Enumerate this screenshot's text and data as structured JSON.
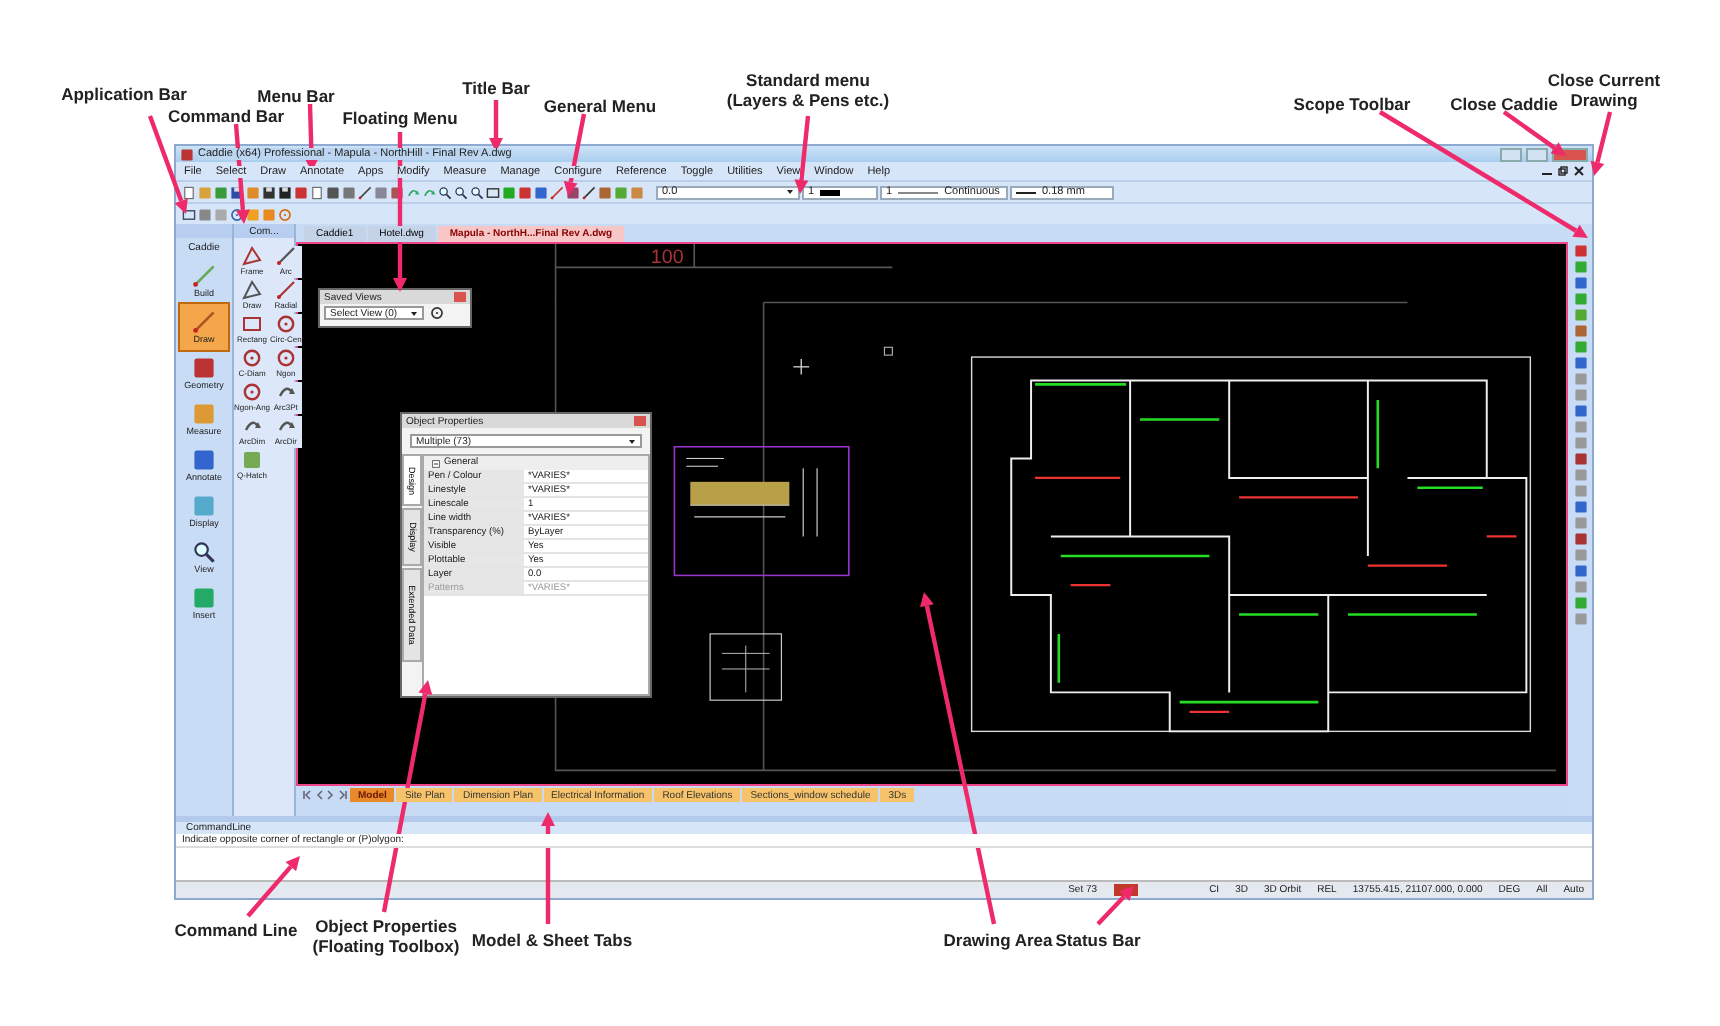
{
  "annotations": [
    {
      "lines": [
        "Application Bar"
      ]
    },
    {
      "lines": [
        "Command Bar"
      ]
    },
    {
      "lines": [
        "Menu Bar"
      ]
    },
    {
      "lines": [
        "Floating Menu"
      ]
    },
    {
      "lines": [
        "Title Bar"
      ]
    },
    {
      "lines": [
        "General Menu"
      ]
    },
    {
      "lines": [
        "Standard menu",
        "(Layers & Pens etc.)"
      ]
    },
    {
      "lines": [
        "Scope Toolbar"
      ]
    },
    {
      "lines": [
        "Close Caddie"
      ]
    },
    {
      "lines": [
        "Close Current",
        "Drawing"
      ]
    },
    {
      "lines": [
        "Command Line"
      ]
    },
    {
      "lines": [
        "Object Properties",
        "(Floating Toolbox)"
      ]
    },
    {
      "lines": [
        "Model & Sheet Tabs"
      ]
    },
    {
      "lines": [
        "Drawing Area"
      ]
    },
    {
      "lines": [
        "Status Bar"
      ]
    }
  ],
  "window": {
    "title": "Caddie (x64) Professional - Mapula - NorthHill - Final Rev A.dwg"
  },
  "menu": [
    "File",
    "Select",
    "Draw",
    "Annotate",
    "Apps",
    "Modify",
    "Measure",
    "Manage",
    "Configure",
    "Reference",
    "Toggle",
    "Utilities",
    "View",
    "Window",
    "Help"
  ],
  "standard_toolbar": {
    "layer": "0.0",
    "pen": "1",
    "linestyle_pen": "1",
    "linestyle": "Continuous",
    "line_width": "0.18 mm"
  },
  "application_bar": {
    "title": "Caddie",
    "items": [
      {
        "label": "Build",
        "selected": false
      },
      {
        "label": "Draw",
        "selected": true
      },
      {
        "label": "Geometry",
        "selected": false
      },
      {
        "label": "Measure",
        "selected": false
      },
      {
        "label": "Annotate",
        "selected": false
      },
      {
        "label": "Display",
        "selected": false
      },
      {
        "label": "View",
        "selected": false
      },
      {
        "label": "Insert",
        "selected": false
      }
    ]
  },
  "command_bar": {
    "title": "Com...",
    "tools": [
      "Frame",
      "Arc",
      "Draw",
      "Radial",
      "Rectang",
      "Circ-Cen",
      "C-Diam",
      "Ngon",
      "Ngon-Ang",
      "Arc3Pt",
      "ArcDim",
      "ArcDir",
      "Q-Hatch"
    ]
  },
  "document_tabs": [
    {
      "label": "Caddie1",
      "selected": false
    },
    {
      "label": "Hotel.dwg",
      "selected": false
    },
    {
      "label": "Mapula - NorthH...Final Rev A.dwg",
      "selected": true
    }
  ],
  "drawing": {
    "scale_label": "100"
  },
  "saved_views": {
    "title": "Saved Views",
    "select": "Select View (0)"
  },
  "object_properties": {
    "title": "Object Properties",
    "select": "Multiple (73)",
    "side_tabs": [
      {
        "label": "Design",
        "selected": true
      },
      {
        "label": "Display",
        "selected": false
      },
      {
        "label": "Extended Data",
        "selected": false
      }
    ],
    "group": "General",
    "rows": [
      {
        "name": "Pen / Colour",
        "value": "*VARIES*",
        "disabled": false
      },
      {
        "name": "Linestyle",
        "value": "*VARIES*",
        "disabled": false
      },
      {
        "name": "Linescale",
        "value": "1",
        "disabled": false
      },
      {
        "name": "Line width",
        "value": "*VARIES*",
        "disabled": false
      },
      {
        "name": "Transparency (%)",
        "value": "ByLayer",
        "disabled": false
      },
      {
        "name": "Visible",
        "value": "Yes",
        "disabled": false
      },
      {
        "name": "Plottable",
        "value": "Yes",
        "disabled": false
      },
      {
        "name": "Layer",
        "value": "0.0",
        "disabled": false
      },
      {
        "name": "Patterns",
        "value": "*VARIES*",
        "disabled": true
      }
    ]
  },
  "sheet_tabs": [
    {
      "label": "Model",
      "selected": true
    },
    {
      "label": "Site Plan",
      "selected": false
    },
    {
      "label": "Dimension Plan",
      "selected": false
    },
    {
      "label": "Electrical Information",
      "selected": false
    },
    {
      "label": "Roof Elevations",
      "selected": false
    },
    {
      "label": "Sections_window schedule",
      "selected": false
    },
    {
      "label": "3Ds",
      "selected": false
    }
  ],
  "command_line": {
    "title": "CommandLine",
    "prompt": "Indicate opposite corner of rectangle or (P)olygon:"
  },
  "status_bar": {
    "items": [
      "Set 73",
      "CI",
      "3D",
      "3D Orbit",
      "REL",
      "13755.415, 21107.000, 0.000",
      "DEG",
      "All",
      "Auto"
    ]
  }
}
